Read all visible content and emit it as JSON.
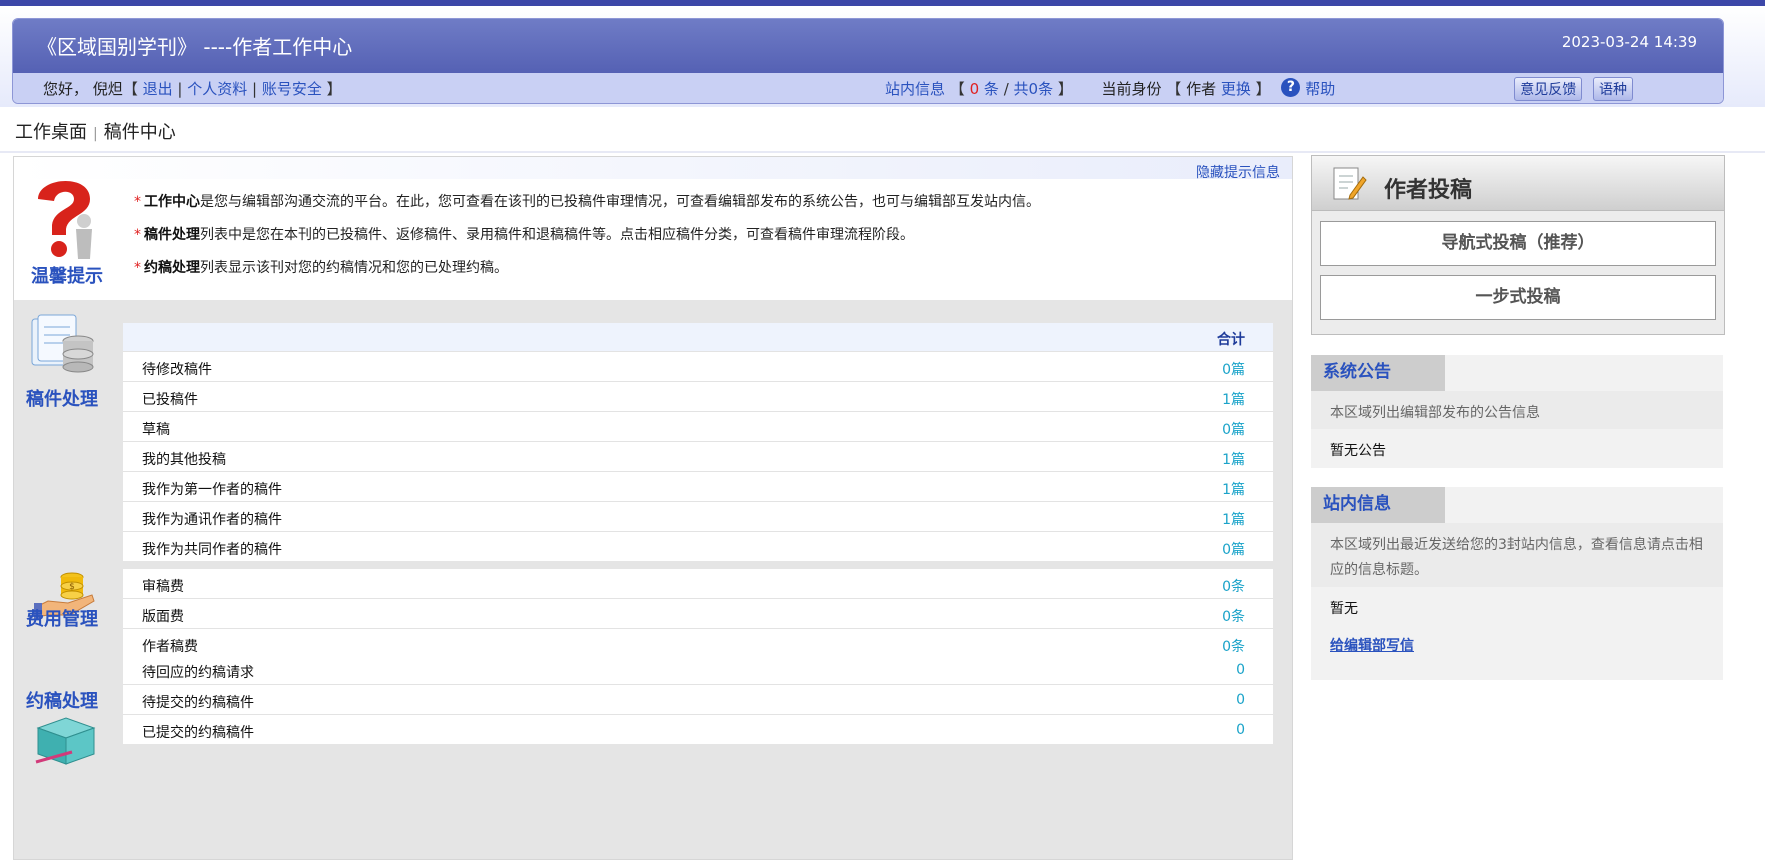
{
  "header": {
    "journal_title": "《区域国别学刊》 ----作者工作中心",
    "datetime": "2023-03-24 14:39",
    "greeting": "您好，",
    "username": "倪炟",
    "logout": "退出",
    "profile": "个人资料",
    "security": "账号安全",
    "messages_label": "站内信息",
    "unread_count": "0",
    "unread_unit": "条",
    "total_text": "共0条",
    "role_label": "当前身份",
    "role_value": "作者",
    "switch_role": "更换",
    "help": "帮助",
    "feedback_button": "意见反馈",
    "language_button": "语种"
  },
  "breadcrumb": {
    "home": "工作桌面",
    "current": "稿件中心"
  },
  "tips": {
    "hide_link": "隐藏提示信息",
    "section_label": "温馨提示",
    "lines": [
      {
        "bold": "工作中心",
        "text": "是您与编辑部沟通交流的平台。在此，您可查看在该刊的已投稿件审理情况，可查看编辑部发布的系统公告，也可与编辑部互发站内信。"
      },
      {
        "bold": "稿件处理",
        "text": "列表中是您在本刊的已投稿件、返修稿件、录用稿件和退稿稿件等。点击相应稿件分类，可查看稿件审理流程阶段。"
      },
      {
        "bold": "约稿处理",
        "text": "列表显示该刊对您的约稿情况和您的已处理约稿。"
      }
    ]
  },
  "manuscripts": {
    "section_label": "稿件处理",
    "total_header": "合计",
    "rows": [
      {
        "label": "待修改稿件",
        "value": "0篇"
      },
      {
        "label": "已投稿件",
        "value": "1篇"
      },
      {
        "label": "草稿",
        "value": "0篇"
      },
      {
        "label": "我的其他投稿",
        "value": "1篇"
      },
      {
        "label": "我作为第一作者的稿件",
        "value": "1篇"
      },
      {
        "label": "我作为通讯作者的稿件",
        "value": "1篇"
      },
      {
        "label": "我作为共同作者的稿件",
        "value": "0篇"
      }
    ]
  },
  "fees": {
    "section_label": "费用管理",
    "rows": [
      {
        "label": "审稿费",
        "value": "0条"
      },
      {
        "label": "版面费",
        "value": "0条"
      },
      {
        "label": "作者稿费",
        "value": "0条"
      }
    ]
  },
  "invitations": {
    "section_label": "约稿处理",
    "rows": [
      {
        "label": "待回应的约稿请求",
        "value": "0"
      },
      {
        "label": "待提交的约稿稿件",
        "value": "0"
      },
      {
        "label": "已提交的约稿稿件",
        "value": "0"
      }
    ]
  },
  "submit_panel": {
    "title": "作者投稿",
    "guided_button": "导航式投稿（推荐）",
    "onestep_button": "一步式投稿"
  },
  "announcements": {
    "title": "系统公告",
    "description": "本区域列出编辑部发布的公告信息",
    "empty_text": "暂无公告"
  },
  "site_messages": {
    "title": "站内信息",
    "description": "本区域列出最近发送给您的3封站内信息，查看信息请点击相应的信息标题。",
    "empty_text": "暂无",
    "write_link": "给编辑部写信"
  },
  "colors": {
    "header_blue": "#5561b4",
    "link_blue": "#2a52be",
    "value_cyan": "#1aa3c9",
    "alert_red": "#e02020"
  }
}
